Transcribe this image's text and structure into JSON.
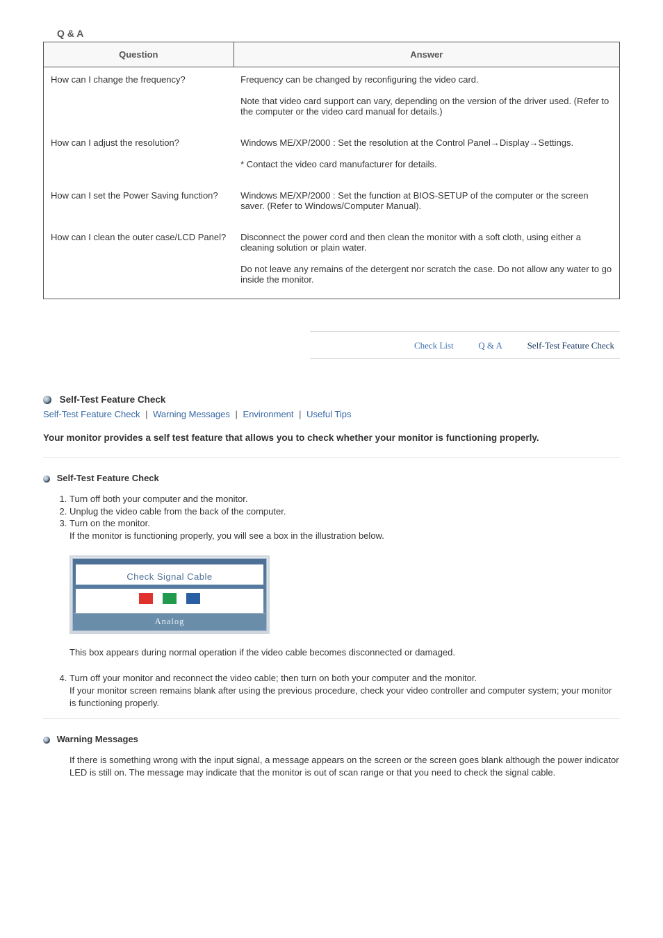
{
  "qa": {
    "title": "Q & A",
    "columns": {
      "q": "Question",
      "a": "Answer"
    },
    "rows": [
      {
        "q": "How can I change the frequency?",
        "a1": "Frequency can be changed by reconfiguring the video card.",
        "a2": "Note that video card support can vary, depending on the version of the driver used. (Refer to the computer or the video card manual for details.)"
      },
      {
        "q": "How can I adjust the resolution?",
        "a1": "Windows ME/XP/2000 : Set the resolution at the Control Panel→Display→Settings.",
        "a2": "* Contact the video card manufacturer for details."
      },
      {
        "q": "How can I set the Power Saving function?",
        "a1": "Windows ME/XP/2000 : Set the function at BIOS-SETUP of the computer or the screen saver. (Refer to Windows/Computer Manual)."
      },
      {
        "q": "How can I clean the outer case/LCD Panel?",
        "a1": "Disconnect the power cord and then clean the monitor with a soft cloth, using either a cleaning solution or plain water.",
        "a2": "Do not leave any remains of the detergent nor scratch the case. Do not allow any water to go inside the monitor."
      }
    ]
  },
  "topnav": {
    "item1": "Check List",
    "item2": "Q & A",
    "item3": "Self-Test Feature Check"
  },
  "self_test": {
    "heading": "Self-Test Feature Check",
    "anchors": {
      "a1": "Self-Test Feature Check",
      "a2": "Warning Messages",
      "a3": "Environment",
      "a4": "Useful Tips"
    },
    "intro": "Your monitor provides a self test feature that allows you to check whether your monitor is functioning properly.",
    "sub_heading": "Self-Test Feature Check",
    "steps": {
      "s1": "Turn off both your computer and the monitor.",
      "s2": "Unplug the video cable from the back of the computer.",
      "s3": "Turn on the monitor.",
      "s3b": "If the monitor is functioning properly, you will see a box in the illustration below."
    },
    "signal_box": {
      "title": "Check Signal Cable",
      "footer": "Analog"
    },
    "below_illustration": "This box appears during normal operation if the video cable becomes disconnected or damaged.",
    "step4": "Turn off your monitor and reconnect the video cable; then turn on both your computer and the monitor.",
    "step4b": "If your monitor screen remains blank after using the previous procedure, check your video controller and computer system; your monitor is functioning properly."
  },
  "warning": {
    "heading": "Warning Messages",
    "para": "If there is something wrong with the input signal, a message appears on the screen or the screen goes blank although the power indicator LED is still on. The message may indicate that the monitor is out of scan range or that you need to check the signal cable."
  },
  "sep": "|"
}
